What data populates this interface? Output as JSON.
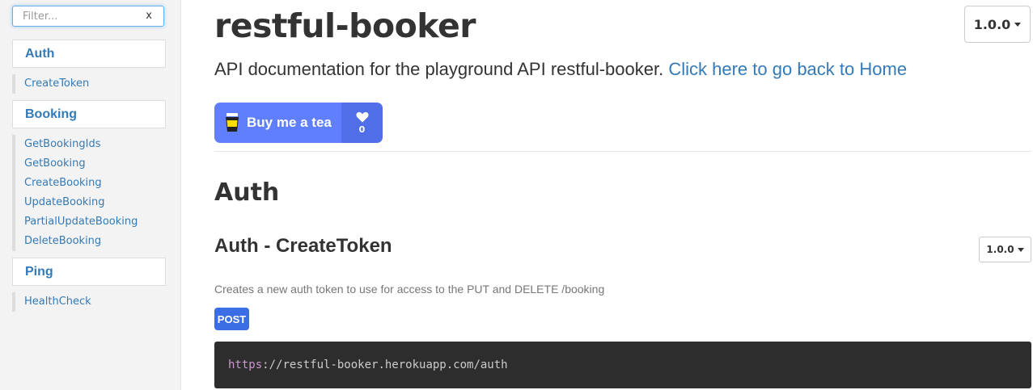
{
  "sidebar": {
    "filter": {
      "placeholder": "Filter...",
      "clear_label": "x"
    },
    "groups": [
      {
        "label": "Auth",
        "items": [
          "CreateToken"
        ]
      },
      {
        "label": "Booking",
        "items": [
          "GetBookingIds",
          "GetBooking",
          "CreateBooking",
          "UpdateBooking",
          "PartialUpdateBooking",
          "DeleteBooking"
        ]
      },
      {
        "label": "Ping",
        "items": [
          "HealthCheck"
        ]
      }
    ]
  },
  "header": {
    "title": "restful-booker",
    "version": "1.0.0",
    "description": "API documentation for the playground API restful-booker.",
    "home_link": "Click here to go back to Home"
  },
  "buy_me_a_tea": {
    "label": "Buy me a tea",
    "count": "0"
  },
  "section": {
    "title": "Auth",
    "endpoint": {
      "title": "Auth - CreateToken",
      "version": "1.0.0",
      "description": "Creates a new auth token to use for access to the PUT and DELETE /booking",
      "method": "POST",
      "url_scheme": "https",
      "url_rest": "://restful-booker.herokuapp.com/auth"
    }
  },
  "colors": {
    "link": "#337ab7",
    "method_post": "#3b6ee5",
    "tea_button": "#5f7fff",
    "code_bg": "#2d2d2d"
  }
}
